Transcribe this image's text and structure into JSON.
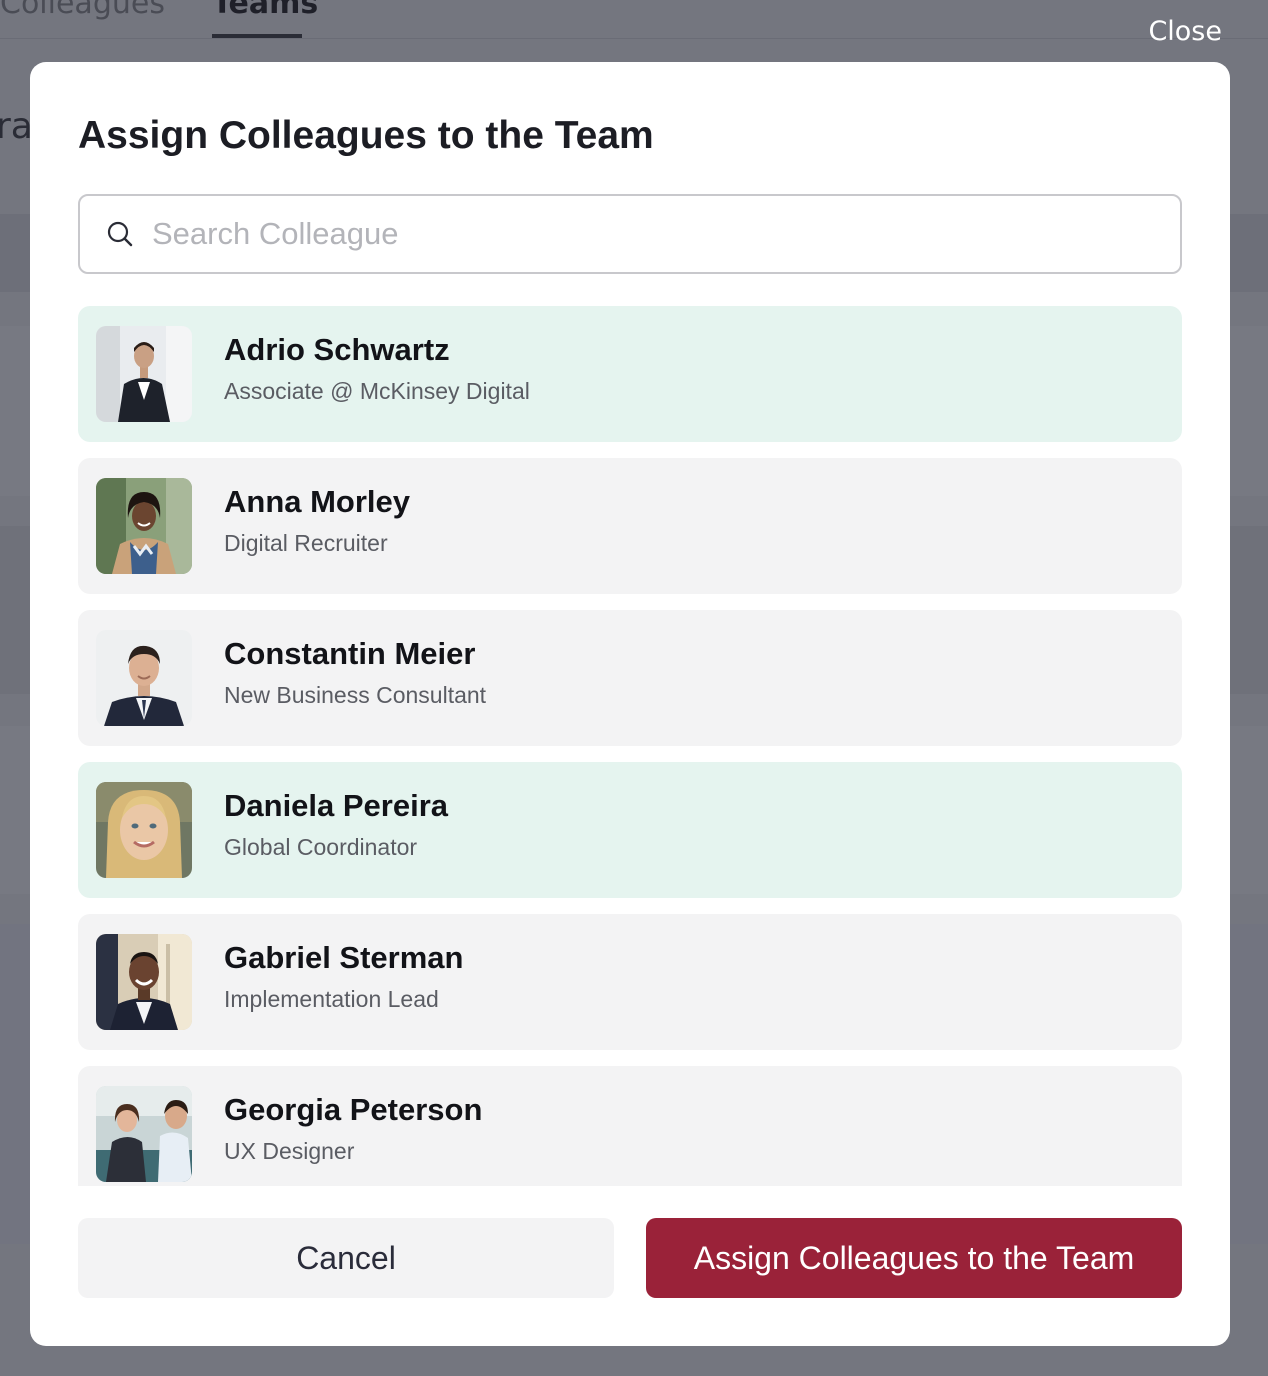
{
  "background": {
    "tabs": [
      "Colleagues",
      "Teams"
    ],
    "fragment": "ra"
  },
  "close_label": "Close",
  "modal": {
    "title": "Assign Colleagues to the Team",
    "search": {
      "placeholder": "Search Colleague",
      "value": ""
    },
    "colleagues": [
      {
        "name": "Adrio Schwartz",
        "role": "Associate @ McKinsey Digital",
        "selected": true,
        "avatar": "man-in-suit-photo"
      },
      {
        "name": "Anna Morley",
        "role": "Digital Recruiter",
        "selected": false,
        "avatar": "woman-with-scarf-photo"
      },
      {
        "name": "Constantin Meier",
        "role": "New Business Consultant",
        "selected": false,
        "avatar": "man-in-suit-photo"
      },
      {
        "name": "Daniela Pereira",
        "role": "Global Coordinator",
        "selected": true,
        "avatar": "blonde-woman-photo"
      },
      {
        "name": "Gabriel Sterman",
        "role": "Implementation Lead",
        "selected": false,
        "avatar": "smiling-man-photo"
      },
      {
        "name": "Georgia Peterson",
        "role": "UX Designer",
        "selected": false,
        "avatar": "woman-in-meeting-photo"
      }
    ],
    "cancel_label": "Cancel",
    "assign_label": "Assign Colleagues to the Team"
  },
  "colors": {
    "selected_row": "#e5f4ef",
    "default_row": "#f3f3f4",
    "primary_button": "#9a2239"
  }
}
